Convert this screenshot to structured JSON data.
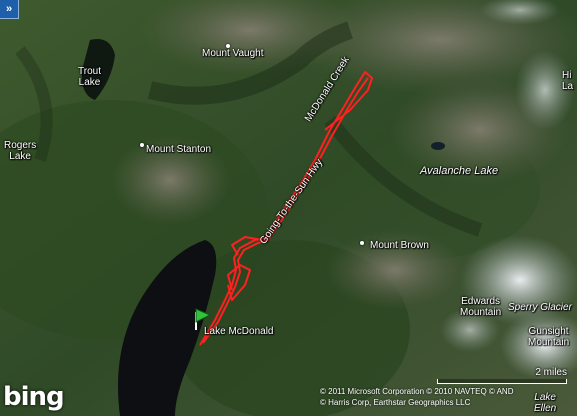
{
  "controls": {
    "expand_label": "»"
  },
  "logo": {
    "text": "bing"
  },
  "places": {
    "trout_lake": "Trout\nLake",
    "mount_vaught": "Mount Vaught",
    "rogers_lake": "Rogers\nLake",
    "mount_stanton": "Mount Stanton",
    "mcdonald_creek": "McDonald Creek",
    "going_to_the_sun_hwy": "Going-To-the-Sun Hwy",
    "avalanche_lake": "Avalanche Lake",
    "mount_brown": "Mount Brown",
    "lake_mcdonald": "Lake McDonald",
    "edwards_mountain": "Edwards\nMountain",
    "sperry_glacier": "Sperry Glacier",
    "gunsight_mountain": "Gunsight\nMountain",
    "lake_ellen": "Lake\nEllen",
    "edge_label_top_right": "Hi\nLa"
  },
  "scale": {
    "label": "2 miles"
  },
  "copyright": {
    "line1": "© 2011 Microsoft Corporation   © 2010 NAVTEQ   © AND",
    "line2": "© Harris Corp, Earthstar Geographics LLC"
  },
  "route": {
    "color": "#ff2020",
    "start_marker_color": "#2fc43a"
  }
}
